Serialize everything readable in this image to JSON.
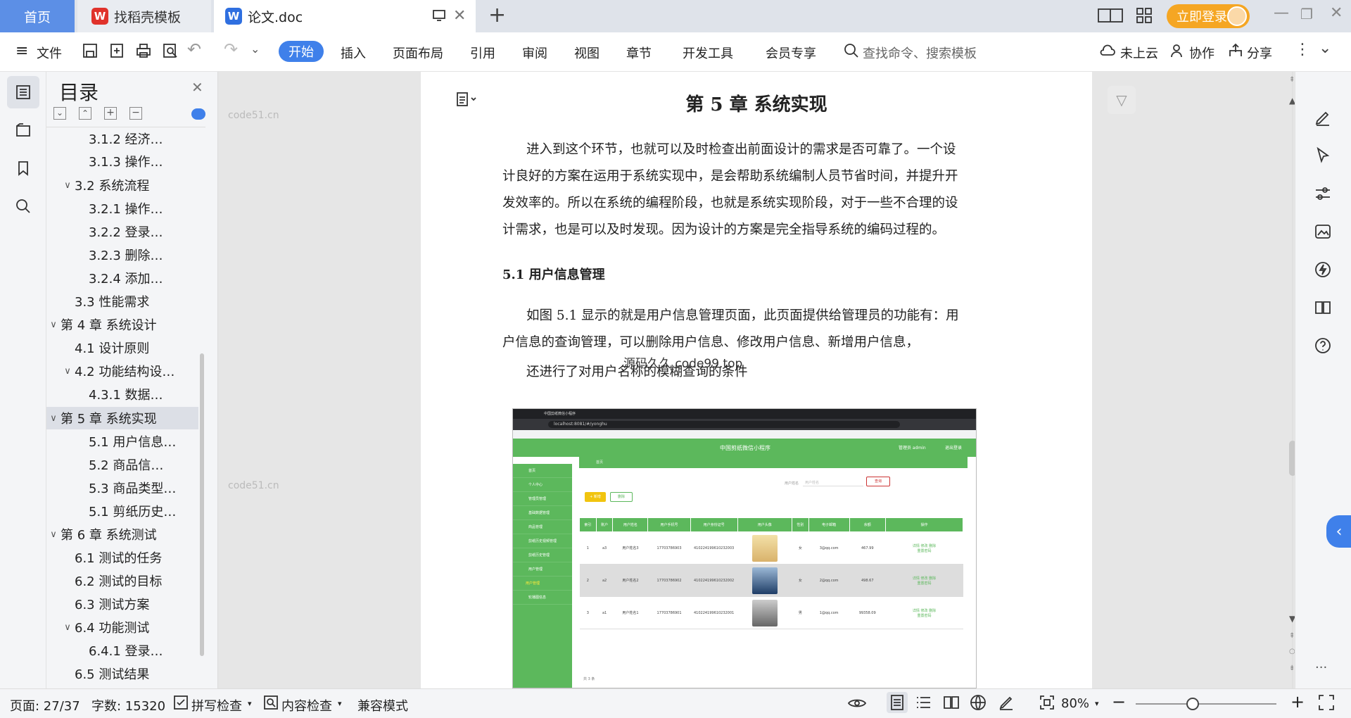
{
  "tabs": {
    "home": "首页",
    "templates": "找稻壳模板",
    "document": "论文.doc"
  },
  "login": "立即登录",
  "ribbon": {
    "file": "文件",
    "start": "开始",
    "items": [
      "插入",
      "页面布局",
      "引用",
      "审阅",
      "视图",
      "章节",
      "开发工具",
      "会员专享"
    ],
    "search_placeholder": "查找命令、搜索模板",
    "cloud": "未上云",
    "collab": "协作",
    "share": "分享"
  },
  "outline": {
    "title": "目录",
    "items": [
      {
        "label": "3.1.2 经济…",
        "level": 3
      },
      {
        "label": "3.1.3 操作…",
        "level": 3
      },
      {
        "label": "3.2 系统流程",
        "level": 2,
        "expanded": true
      },
      {
        "label": "3.2.1 操作…",
        "level": 3
      },
      {
        "label": "3.2.2 登录…",
        "level": 3
      },
      {
        "label": "3.2.3 删除…",
        "level": 3
      },
      {
        "label": "3.2.4 添加…",
        "level": 3
      },
      {
        "label": "3.3 性能需求",
        "level": 2
      },
      {
        "label": "第 4 章 系统设计",
        "level": 1,
        "expanded": true
      },
      {
        "label": "4.1 设计原则",
        "level": 2
      },
      {
        "label": "4.2 功能结构设…",
        "level": 2,
        "expanded": true
      },
      {
        "label": "4.3.1 数据…",
        "level": 3
      },
      {
        "label": "第 5 章 系统实现",
        "level": 1,
        "expanded": true,
        "active": true
      },
      {
        "label": "5.1 用户信息…",
        "level": 3
      },
      {
        "label": "5.2 商品信…",
        "level": 3
      },
      {
        "label": "5.3 商品类型…",
        "level": 3
      },
      {
        "label": "5.1 剪纸历史…",
        "level": 3
      },
      {
        "label": "第 6 章 系统测试",
        "level": 1,
        "expanded": true
      },
      {
        "label": "6.1 测试的任务",
        "level": 2
      },
      {
        "label": "6.2 测试的目标",
        "level": 2
      },
      {
        "label": "6.3 测试方案",
        "level": 2
      },
      {
        "label": "6.4 功能测试",
        "level": 2,
        "expanded": true
      },
      {
        "label": "6.4.1 登录…",
        "level": 3
      },
      {
        "label": "6.5 测试结果",
        "level": 2
      }
    ]
  },
  "document": {
    "chapter_title": "第 5 章  系统实现",
    "para1": [
      "进入到这个环节，也就可以及时检查出前面设计的需求是否可靠了。一个设",
      "计良好的方案在运用于系统实现中，是会帮助系统编制人员节省时间，并提升开",
      "发效率的。所以在系统的编程阶段，也就是系统实现阶段，对于一些不合理的设",
      "计需求，也是可以及时发现。因为设计的方案是完全指导系统的编码过程的。"
    ],
    "section_title": "5.1 用户信息管理",
    "para2": [
      "如图 5.1 显示的就是用户信息管理页面，此页面提供给管理员的功能有：用",
      "户信息的查询管理，可以删除用户信息、修改用户信息、新增用户信息，",
      "还进行了对用户名称的模糊查询的条件"
    ],
    "overlay_watermark": "源码久久 code99.top",
    "watermark": "code51.cn"
  },
  "screenshot": {
    "browser_tab": "中国剪纸微信小程序",
    "url": "localhost:8081/#/yonghu",
    "app_title": "中国剪纸微信小程序",
    "admin_text": "管理员 admin",
    "logout": "退出登录",
    "breadcrumb": "首页",
    "search_label": "用户姓名",
    "search_placeholder": "用户姓名",
    "search_btn": "查询",
    "add_btn": "+ 新增",
    "delete_btn": "删除",
    "sidebar": [
      "首页",
      "个人中心",
      "管理员管理",
      "基础数据管理",
      "商品管理",
      "剪纸历史视频管理",
      "剪纸历史管理",
      "用户管理",
      "用户管理",
      "轮播图信息"
    ],
    "columns": [
      "索引",
      "账户",
      "用户姓名",
      "用户手机号",
      "用户身份证号",
      "用户头像",
      "性别",
      "电子邮箱",
      "余额",
      "操作"
    ],
    "rows": [
      {
        "idx": "1",
        "acct": "a3",
        "name": "用户姓名3",
        "phone": "17703786903",
        "id": "410224199610232003",
        "gender": "女",
        "email": "3@qq.com",
        "bal": "467.99"
      },
      {
        "idx": "2",
        "acct": "a2",
        "name": "用户姓名2",
        "phone": "17703786902",
        "id": "410224199610232002",
        "gender": "女",
        "email": "2@qq.com",
        "bal": "498.67"
      },
      {
        "idx": "3",
        "acct": "a1",
        "name": "用户姓名1",
        "phone": "17703786901",
        "id": "410224199610232001",
        "gender": "男",
        "email": "1@qq.com",
        "bal": "99358.09"
      }
    ],
    "ops": [
      "详情",
      "修改",
      "删除",
      "重置密码"
    ],
    "pager": "共 3 条"
  },
  "status": {
    "page": "页面: 27/37",
    "words": "字数: 15320",
    "spell": "拼写检查",
    "content": "内容检查",
    "compat": "兼容模式",
    "zoom": "80%"
  },
  "colors": {
    "accent": "#3f80ea",
    "login": "#f5a623",
    "app_green": "#5cb85c"
  }
}
